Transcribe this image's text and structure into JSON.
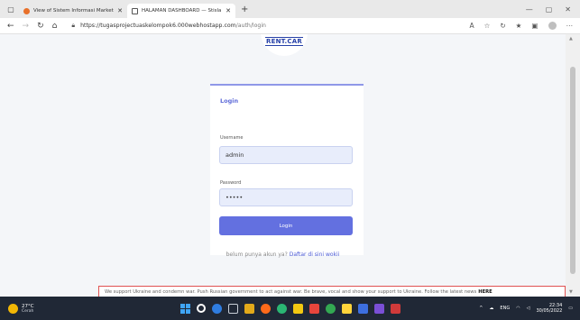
{
  "browser": {
    "tabs": [
      {
        "title": "View of Sistem Informasi Market",
        "active": false,
        "favicon_color": "#e8702a"
      },
      {
        "title": "HALAMAN DASHBOARD — Stisla",
        "active": true,
        "favicon_color": "#ffffff"
      }
    ],
    "url_host": "https://tugasprojectuaskelompok6.000webhostapp.com",
    "url_path": "/auth/login"
  },
  "page": {
    "logo_text": "RENT.CAR",
    "card_title": "Login",
    "username_label": "Username",
    "username_value": "admin",
    "password_label": "Password",
    "password_value": "•••••",
    "login_button": "Login",
    "signup_text": "belum punya akun ya?",
    "signup_link": "Daftar di sini wokii",
    "banner_text": "We support Ukraine and condemn war. Push Russian government to act against war. Be brave, vocal and show your support to Ukraine. Follow the latest news",
    "banner_link": "HERE"
  },
  "taskbar": {
    "temperature": "27°C",
    "condition": "Cerah",
    "language": "ENG",
    "time": "22:34",
    "date": "30/05/2022",
    "app_colors": [
      "#3fa5f5",
      "#ffffff",
      "#2f7de1",
      "#6b7a91",
      "#e2a91a",
      "#ff6a1a",
      "#2bb673",
      "#f2c811",
      "#e8453c",
      "#33a852",
      "#ffd43b",
      "#3d6fe0",
      "#7a4fd6",
      "#d03a3a"
    ]
  }
}
